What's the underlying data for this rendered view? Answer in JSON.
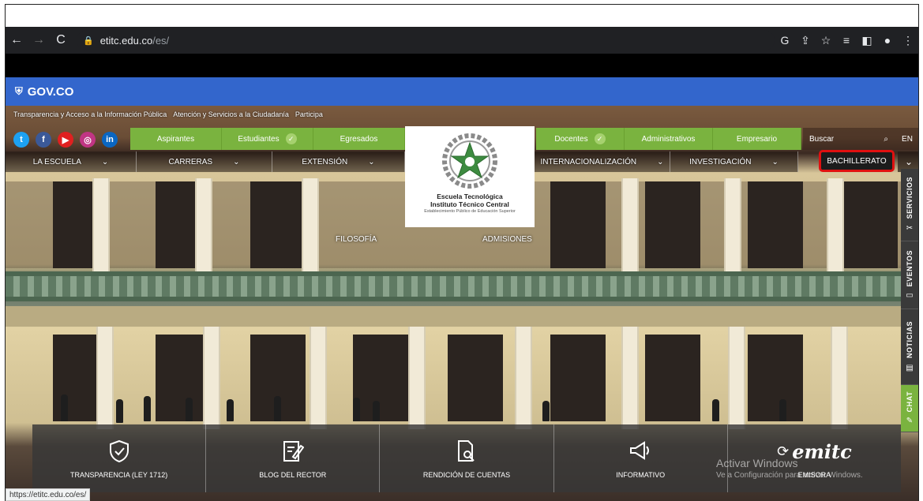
{
  "browser": {
    "url_host": "etitc.edu.co",
    "url_path": "/es/",
    "back_icon": "arrow-left",
    "forward_icon": "arrow-right",
    "reload_icon": "reload",
    "lock_icon": "lock"
  },
  "gov": {
    "label": "GOV.CO"
  },
  "top_links": [
    "Transparencia y Acceso a la Información Pública",
    "Atención y Servicios a la Ciudadanía",
    "Participa"
  ],
  "audiences": [
    "Aspirantes",
    "Estudiantes",
    "Egresados",
    "Docentes",
    "Administrativos",
    "Empresario"
  ],
  "search": {
    "placeholder": "Buscar"
  },
  "lang": "EN",
  "nav": [
    "LA ESCUELA",
    "CARRERAS",
    "EXTENSIÓN",
    "INTERNACIONALIZACIÓN",
    "INVESTIGACIÓN",
    "BACHILLERATO"
  ],
  "logo": {
    "line1": "Escuela Tecnológica",
    "line2": "Instituto Técnico Central",
    "line3": "Establecimiento Público de Educación Superior"
  },
  "hero_links": [
    "FILOSOFÍA",
    "ADMISIONES"
  ],
  "side_tabs": [
    "SERVICIOS",
    "EVENTOS",
    "NOTICIAS",
    "CHAT"
  ],
  "bottom": [
    "TRANSPARENCIA (LEY 1712)",
    "BLOG DEL RECTOR",
    "RENDICIÓN DE CUENTAS",
    "INFORMATIVO",
    "EMISORA"
  ],
  "emitc": "emitc",
  "watermark": {
    "line1": "Activar Windows",
    "line2": "Ve a Configuración para activar Windows."
  },
  "status_url": "https://etitc.edu.co/es/",
  "colors": {
    "gov_blue": "#3366cc",
    "green": "#7ab33f",
    "highlight_red": "#e01010"
  }
}
